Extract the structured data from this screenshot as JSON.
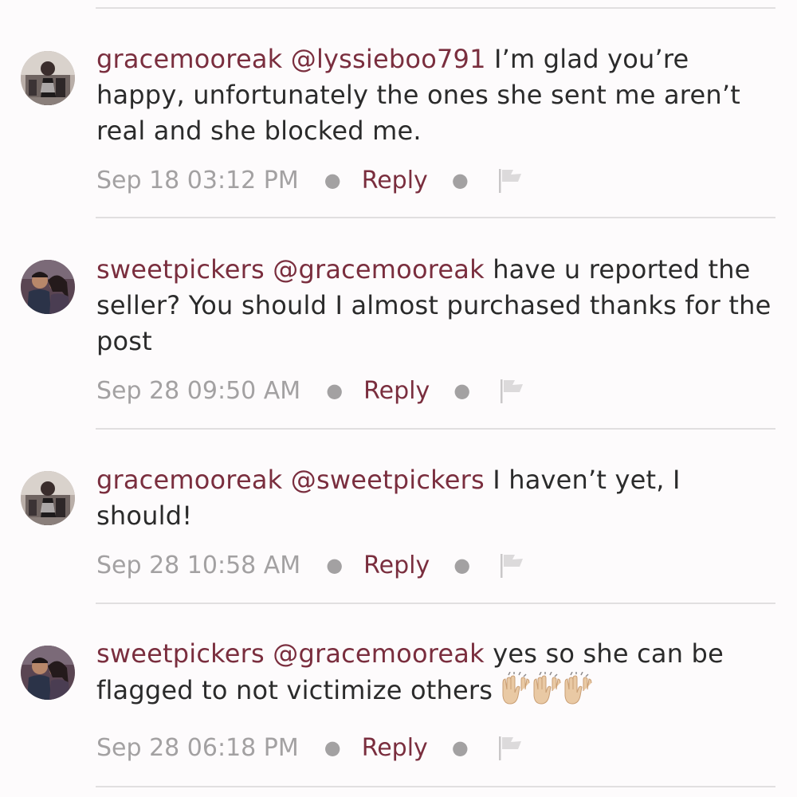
{
  "comments": [
    {
      "username": "gracemooreak",
      "mention": "@lyssieboo791",
      "text": " I’m glad you’re happy, unfortunately the ones she sent me aren’t real and she blocked me.",
      "timestamp": "Sep 18 03:12 PM",
      "reply_label": "Reply",
      "avatar": "avatar-gracemooreak"
    },
    {
      "username": "sweetpickers",
      "mention": "@gracemooreak",
      "text": " have u reported the seller? You should I almost purchased thanks for the post",
      "timestamp": "Sep 28 09:50 AM",
      "reply_label": "Reply",
      "avatar": "avatar-sweetpickers"
    },
    {
      "username": "gracemooreak",
      "mention": "@sweetpickers",
      "text": " I haven’t yet, I should!",
      "timestamp": "Sep 28 10:58 AM",
      "reply_label": "Reply",
      "avatar": "avatar-gracemooreak"
    },
    {
      "username": "sweetpickers",
      "mention": "@gracemooreak",
      "text": " yes so she can be flagged to not victimize others",
      "emoji": "🙌🙌🙌",
      "timestamp": "Sep 28 06:18 PM",
      "reply_label": "Reply",
      "avatar": "avatar-sweetpickers"
    }
  ],
  "icons": {
    "flag": "flag-icon",
    "emoji": "raising-hands-icon"
  },
  "colors": {
    "username": "#7a2e3e",
    "text": "#2b2b2b",
    "meta": "#a3a1a2",
    "divider": "#e1dfe0",
    "background": "#fdfbfc"
  }
}
